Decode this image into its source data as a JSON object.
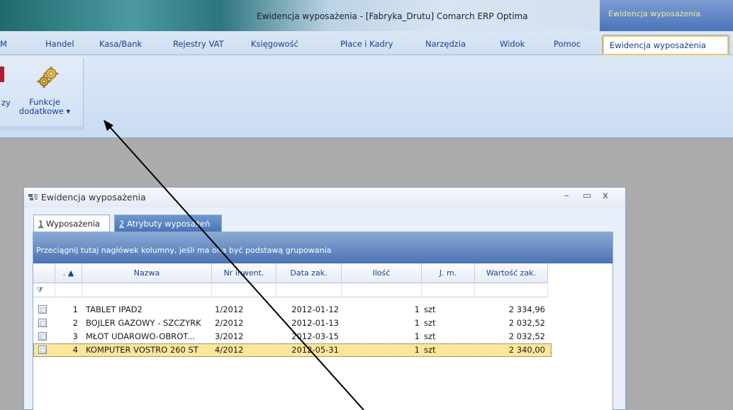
{
  "titlebar": {
    "title": "Ewidencja wyposażenia - [Fabryka_Drutu] Comarch ERP Optima",
    "context_tab": "Ewidencja wyposażenia"
  },
  "ribbon_tabs": [
    "Handel",
    "Kasa/Bank",
    "Rejestry VAT",
    "Księgowość",
    "Płace i Kadry",
    "Narzędzia",
    "Widok",
    "Pomoc",
    "Ewidencja wyposażenia"
  ],
  "ribbon": {
    "partial_label": "zy",
    "funkcje_line1": "Funkcje",
    "funkcje_line2": "dodatkowe ▾"
  },
  "window": {
    "title": "Ewidencja wyposażenia",
    "minimize": "–",
    "maximize": "▭",
    "close": "x",
    "tab1_num": "1",
    "tab1_text": " Wyposażenia",
    "tab2_num": "2",
    "tab2_text": " Atrybuty wyposażeń",
    "group_hint": "Przeciągnij tutaj nagłówek kolumny, jeśli ma ona być podstawą grupowania"
  },
  "grid": {
    "columns": [
      ". ▲",
      "Nazwa",
      "Nr inwent.",
      "Data zak.",
      "Ilość",
      "J. m.",
      "Wartość zak."
    ],
    "rows": [
      {
        "lp": "1",
        "nazwa": "TABLET IPAD2",
        "nr": "1/2012",
        "data": "2012-01-12",
        "ilosc": "1",
        "jm": "szt",
        "wartosc": "2 334,96"
      },
      {
        "lp": "2",
        "nazwa": "BOJLER GAZOWY - SZCZYRK",
        "nr": "2/2012",
        "data": "2012-01-13",
        "ilosc": "1",
        "jm": "szt",
        "wartosc": "2 032,52"
      },
      {
        "lp": "3",
        "nazwa": "MŁOT UDAROWO-OBROT...",
        "nr": "3/2012",
        "data": "2012-03-15",
        "ilosc": "1",
        "jm": "szt",
        "wartosc": "2 032,52"
      },
      {
        "lp": "4",
        "nazwa": "KOMPUTER VOSTRO 260 ST",
        "nr": "4/2012",
        "data": "2012-05-31",
        "ilosc": "1",
        "jm": "szt",
        "wartosc": "2 340,00"
      }
    ],
    "selected_row": 4
  },
  "colors": {
    "accent": "#15428b",
    "selected_row": "#fde69b",
    "group_bar": "#4c74b3",
    "context_tab_text": "#f2e7a3"
  }
}
